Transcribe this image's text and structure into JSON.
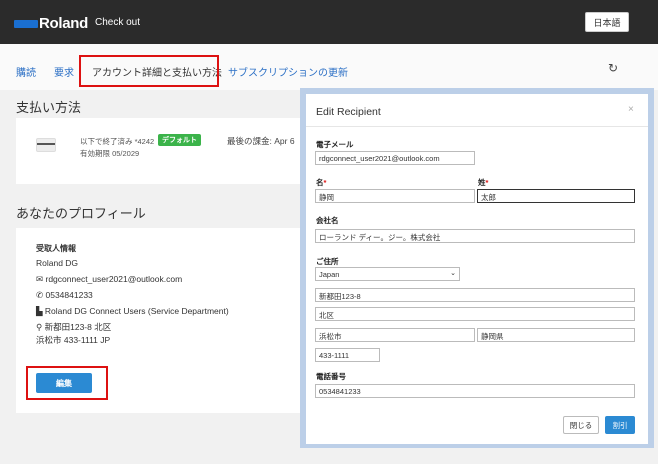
{
  "header": {
    "brand": "Roland",
    "checkout_label": "Check out",
    "language_button": "日本語"
  },
  "tabs": [
    {
      "label": "購読"
    },
    {
      "label": "要求"
    },
    {
      "label": "アカウント詳細と支払い方法"
    },
    {
      "label": "サブスクリプションの更新"
    }
  ],
  "payment": {
    "section_title": "支払い方法",
    "card_text": "以下で終了済み *4242",
    "default_badge": "デフォルト",
    "expiry": "有効期限 05/2029",
    "last_charge": "最後の課金: Apr 6"
  },
  "profile": {
    "section_title": "あなたのプロフィール",
    "heading": "受取人情報",
    "name": "Roland DG",
    "email": "rdgconnect_user2021@outlook.com",
    "phone": "0534841233",
    "company": "Roland DG Connect Users (Service Department)",
    "address_line1": "新都田123-8 北区",
    "address_line2": "浜松市 433-1111 JP",
    "edit_button": "編集"
  },
  "modal": {
    "title": "Edit Recipient",
    "close_glyph": "×",
    "email_label": "電子メール",
    "email_value": "rdgconnect_user2021@outlook.com",
    "first_name_label": "名",
    "first_name_value": "静岡",
    "last_name_label": "姓",
    "last_name_value": "太郎",
    "company_label": "会社名",
    "company_value": "ローランド ディー。ジー。株式会社",
    "address_label": "ご住所",
    "country_value": "Japan",
    "street_value": "新都田123-8",
    "district_value": "北区",
    "city_value": "浜松市",
    "prefecture_value": "静岡県",
    "postal_value": "433-1111",
    "phone_label": "電話番号",
    "phone_value": "0534841233",
    "cancel_button": "閉じる",
    "save_button": "割引",
    "required_mark": "*"
  },
  "colors": {
    "header_bg": "#2b2b2b",
    "brand_blue": "#1a6fd1",
    "link_blue": "#2b6fc5",
    "button_blue": "#2b8ad3",
    "badge_green": "#3bb34a",
    "highlight_red": "#dd1111"
  }
}
